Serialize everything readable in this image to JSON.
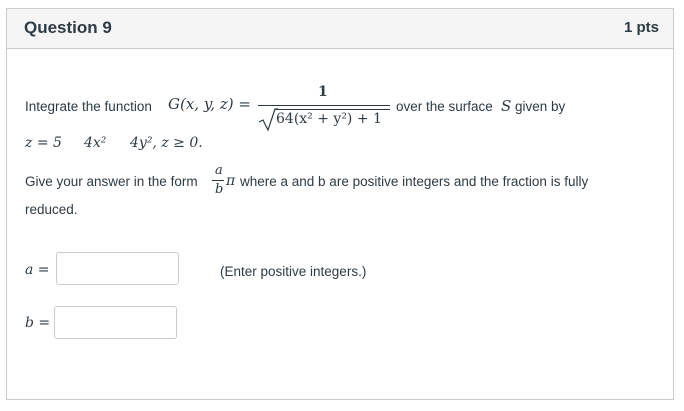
{
  "question": {
    "title": "Question 9",
    "points": "1 pts"
  },
  "prompt": {
    "line1_prefix": "Integrate the function",
    "function_name": "G(x, y, z) =",
    "numerator": "1",
    "denominator": "64(x² + y²) + 1",
    "line1_suffix": "over the surface",
    "surface_symbol": "S",
    "given_by": "given by",
    "surface_eq_z": "z = 5",
    "surface_eq_t2": "4x²",
    "surface_eq_t3": "4y², z ≥ 0."
  },
  "answer_form": {
    "prefix": "Give your answer in the form",
    "frac_num": "a",
    "frac_den": "b",
    "pi": "π",
    "suffix": "where a and b are positive integers and the fraction is fully",
    "suffix2": "reduced."
  },
  "inputs": {
    "a_label": "a =",
    "b_label": "b =",
    "a_value": "",
    "b_value": "",
    "hint": "(Enter positive integers.)"
  }
}
